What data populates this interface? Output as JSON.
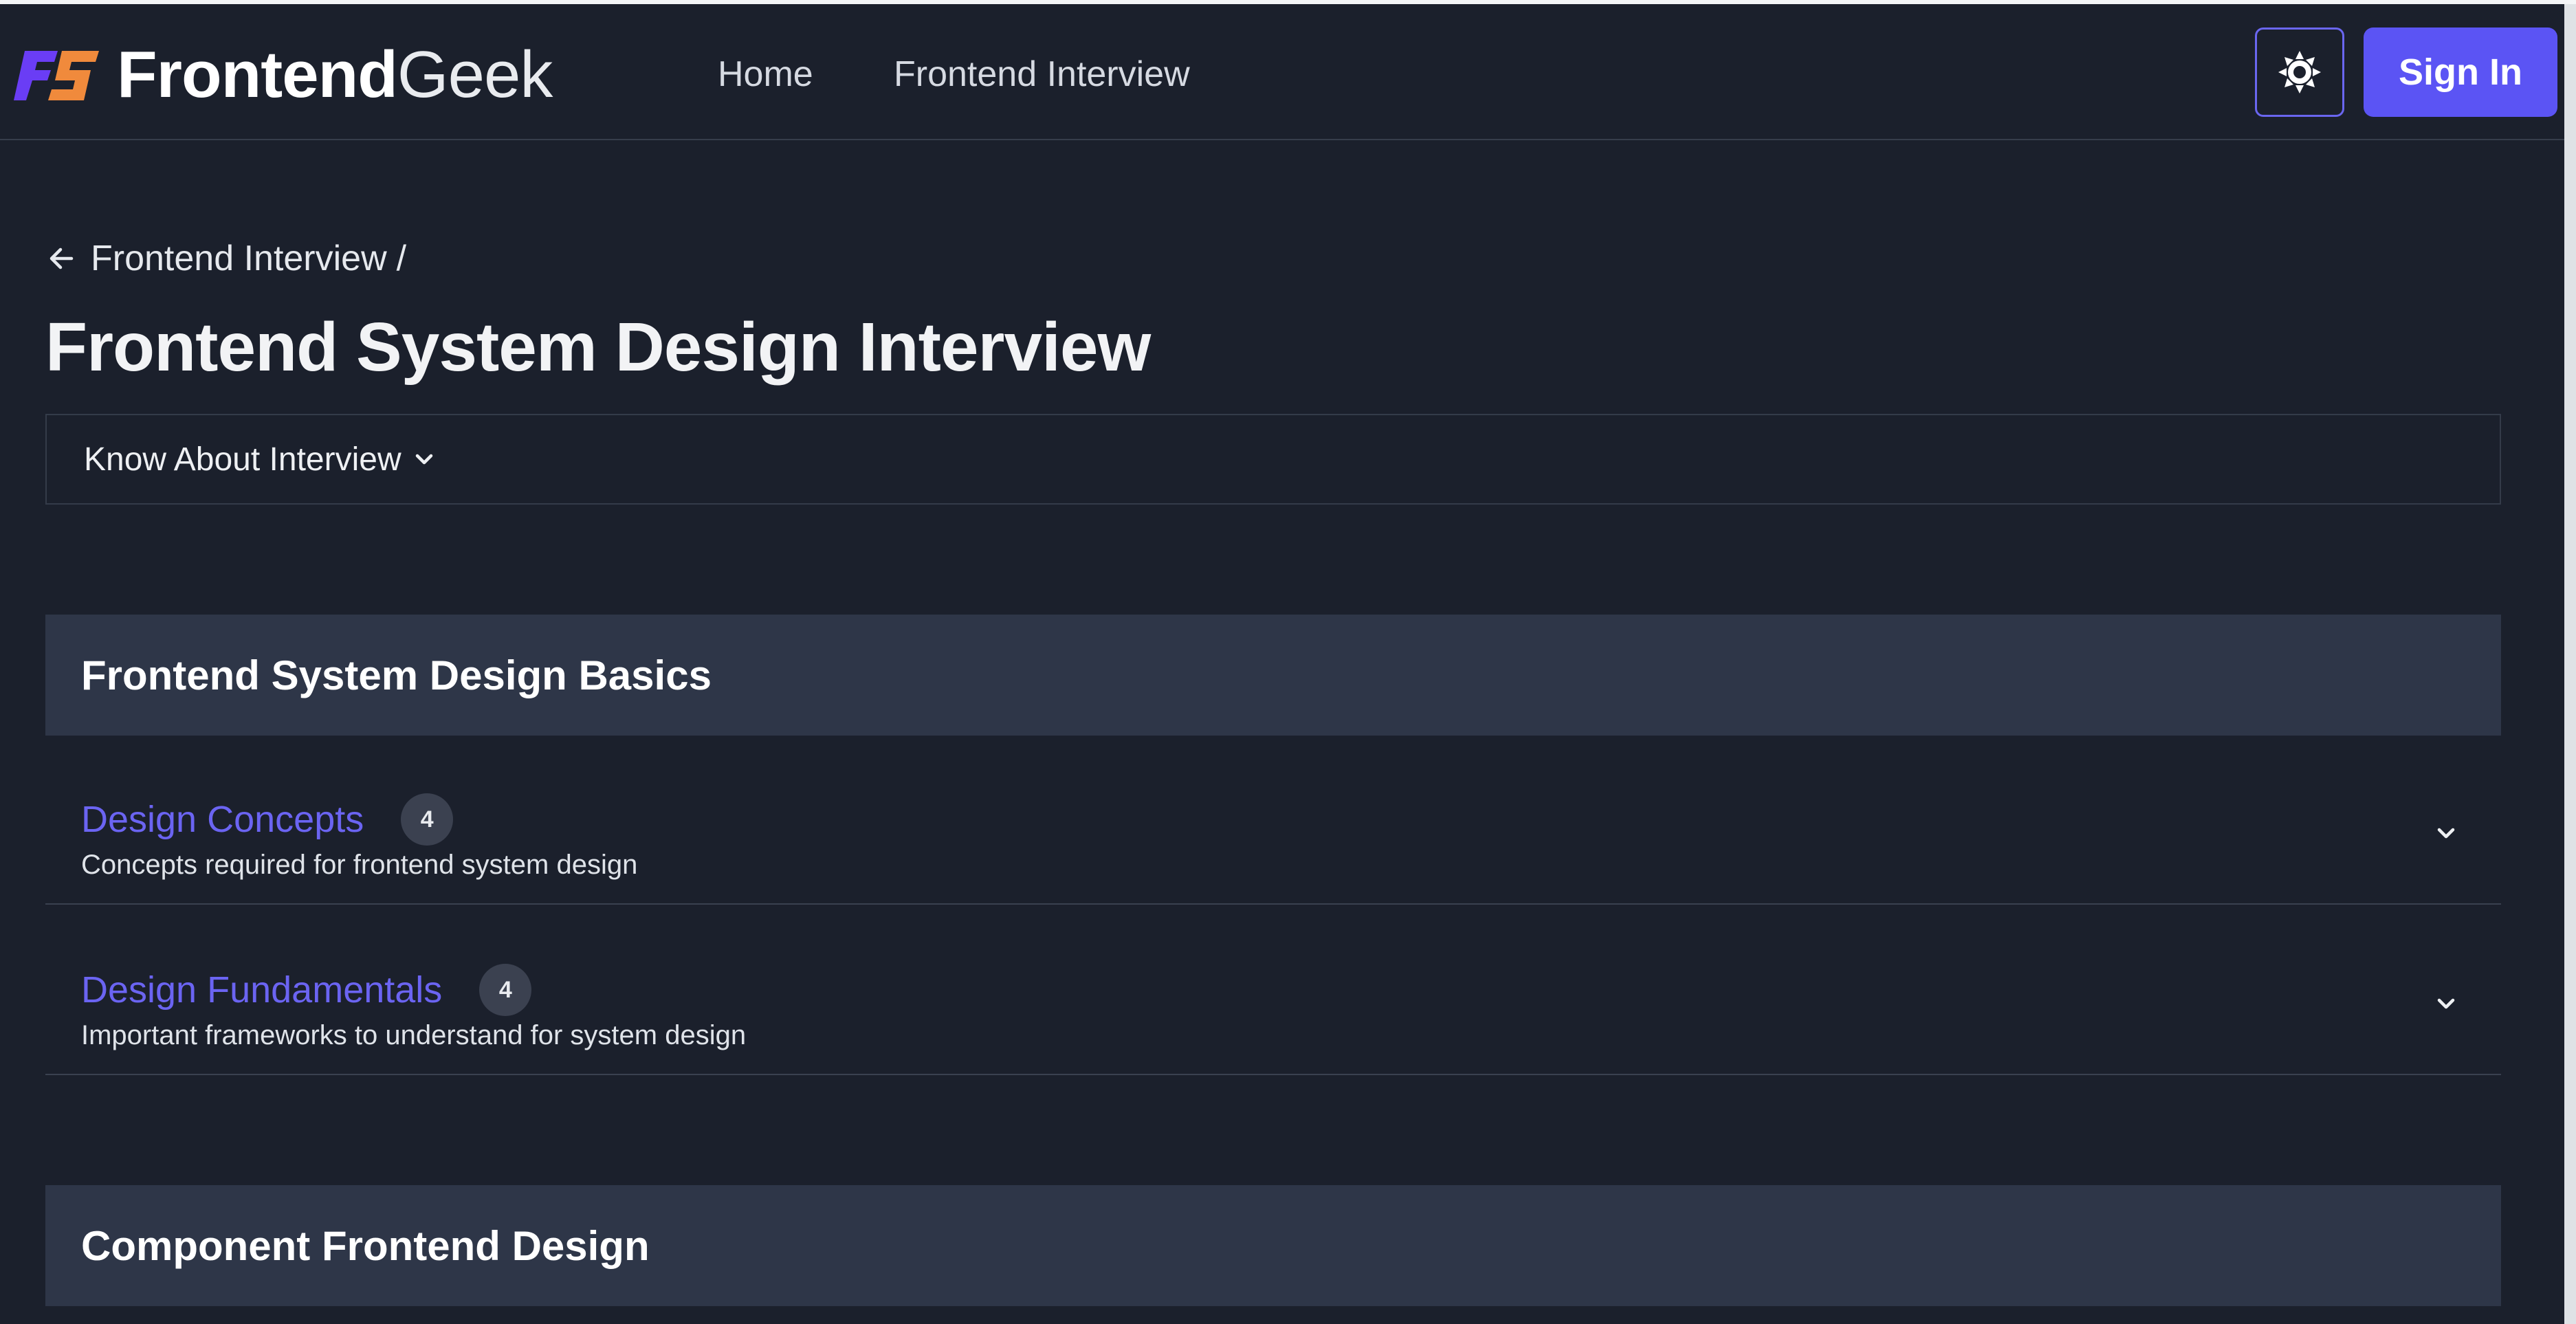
{
  "header": {
    "logo_bold": "Frontend",
    "logo_light": "Geek",
    "nav": [
      "Home",
      "Frontend Interview"
    ],
    "theme_icon": "sun-icon",
    "signin_label": "Sign In"
  },
  "breadcrumb": {
    "back_icon": "arrow-left-icon",
    "parent": "Frontend Interview",
    "separator": "/"
  },
  "page_title": "Frontend System Design Interview",
  "know_panel": {
    "label": "Know About Interview",
    "icon": "chevron-down-icon"
  },
  "sections": [
    {
      "title": "Frontend System Design Basics",
      "topics": [
        {
          "title": "Design Concepts",
          "count": "4",
          "description": "Concepts required for frontend system design"
        },
        {
          "title": "Design Fundamentals",
          "count": "4",
          "description": "Important frameworks to understand for system design"
        }
      ]
    },
    {
      "title": "Component Frontend Design",
      "topics": []
    }
  ],
  "colors": {
    "background": "#1b202c",
    "section_header": "#2e3648",
    "accent": "#5b54f4",
    "topic_link": "#6b64f2",
    "logo_purple": "#6a3df5",
    "logo_orange": "#f08a3c"
  }
}
